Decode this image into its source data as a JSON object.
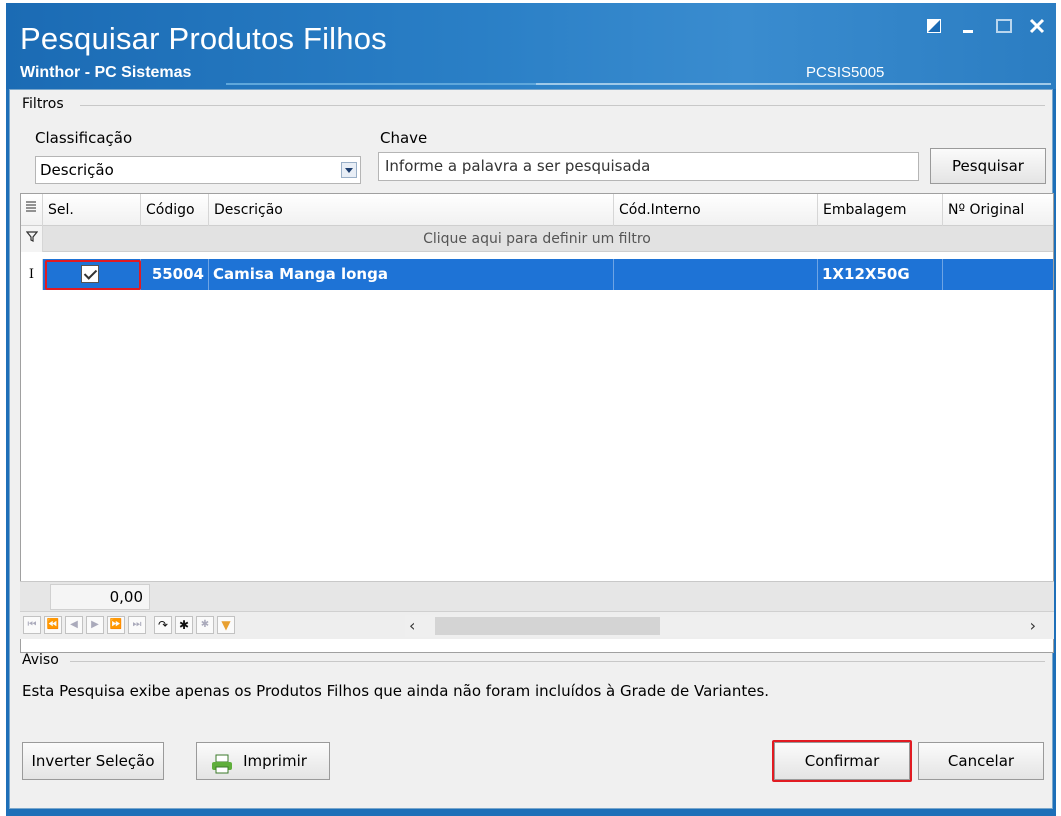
{
  "window": {
    "title": "Pesquisar Produtos Filhos",
    "subtitle": "Winthor - PC Sistemas",
    "system_code": "PCSIS5005",
    "controls": [
      "restore-icon",
      "minimize-icon",
      "maximize-icon",
      "close-icon"
    ]
  },
  "filters": {
    "group_label": "Filtros",
    "classificacao_label": "Classificação",
    "classificacao_value": "Descrição",
    "chave_label": "Chave",
    "chave_placeholder": "Informe a palavra a ser pesquisada",
    "search_button": "Pesquisar"
  },
  "grid": {
    "columns": [
      "Sel.",
      "Código",
      "Descrição",
      "Cód.Interno",
      "Embalagem",
      "Nº Original"
    ],
    "filter_hint": "Clique aqui para definir um filtro",
    "rows": [
      {
        "selected": true,
        "codigo": "55004",
        "descricao": "Camisa Manga longa",
        "cod_interno": "",
        "embalagem": "1X12X50G",
        "n_original": ""
      }
    ],
    "footer_total": "0,00"
  },
  "aviso": {
    "label": "Aviso",
    "text": "Esta Pesquisa exibe apenas os Produtos Filhos que ainda não foram incluídos à Grade de Variantes."
  },
  "buttons": {
    "invert_selection": "Inverter Seleção",
    "print": "Imprimir",
    "confirm": "Confirmar",
    "cancel": "Cancelar"
  },
  "colors": {
    "titlebar": "#1b6bb4",
    "selected_row": "#1e73d6",
    "highlight": "#e11b22"
  }
}
